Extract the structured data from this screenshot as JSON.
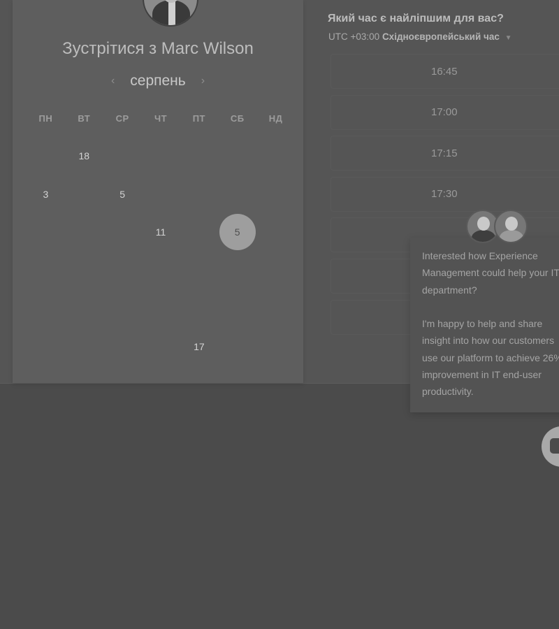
{
  "organizer": {
    "meet_title": "Зустрітися з Marc Wilson"
  },
  "calendar": {
    "month": "серпень",
    "prev_icon": "chevron-left-icon",
    "next_icon": "chevron-right-icon",
    "weekdays": [
      "ПН",
      "ВТ",
      "СР",
      "ЧТ",
      "ПТ",
      "СБ",
      "НД"
    ],
    "weeks": [
      [
        "",
        "18",
        "",
        "",
        "",
        "",
        ""
      ],
      [
        "3",
        "",
        "5",
        "",
        "",
        "",
        ""
      ],
      [
        "",
        "",
        "",
        "11",
        "",
        "5",
        ""
      ],
      [
        "",
        "",
        "",
        "",
        "",
        "",
        ""
      ],
      [
        "",
        "",
        "",
        "",
        "",
        "",
        ""
      ],
      [
        "",
        "",
        "",
        "",
        "17",
        "",
        ""
      ]
    ],
    "selected_day": "5"
  },
  "time_panel": {
    "heading": "Який час є найліпшим для вас?",
    "timezone_offset": "UTC +03:00",
    "timezone_name": "Східноєвропейський час",
    "slots": [
      "16:45",
      "17:00",
      "17:15",
      "17:30",
      "",
      "",
      ""
    ]
  },
  "chat": {
    "message": "Interested how Experience Management could help your IT department?\n\nI'm happy to help and share insight into how our customers use our platform to achieve 26% improvement in IT end-user productivity."
  }
}
